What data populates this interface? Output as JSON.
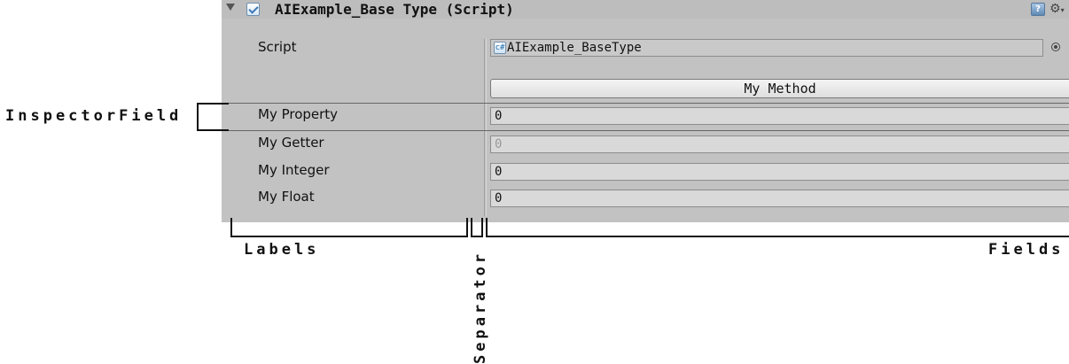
{
  "component": {
    "title": "AIExample_Base Type (Script)",
    "script_label": "Script",
    "script_value": "AIExample_BaseType",
    "script_icon_glyph": "c#",
    "help_icon_glyph": "?",
    "gear_icon_glyph": "⚙",
    "method_button_label": "My Method",
    "fields": [
      {
        "label": "My Property",
        "value": "0",
        "enabled": true
      },
      {
        "label": "My Getter",
        "value": "0",
        "enabled": false
      },
      {
        "label": "My Integer",
        "value": "0",
        "enabled": true
      },
      {
        "label": "My Float",
        "value": "0",
        "enabled": true
      }
    ]
  },
  "annotations": {
    "inspector_field": "InspectorField",
    "labels": "Labels",
    "separator": "Separator",
    "fields": "Fields"
  },
  "icons": [
    "foldout-arrow-icon",
    "script-icon",
    "enabled-checkbox",
    "help-icon",
    "gear-icon",
    "object-picker-icon"
  ]
}
